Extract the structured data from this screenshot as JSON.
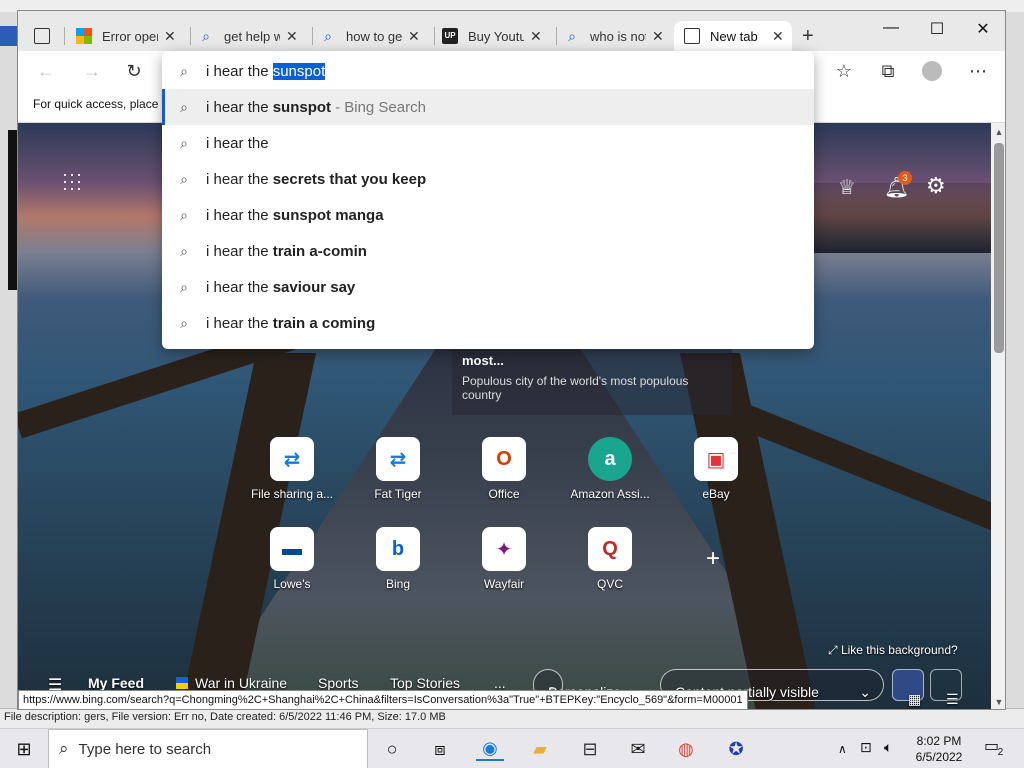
{
  "window": {
    "title": "New tab",
    "minimize": "—",
    "maximize": "☐",
    "close": "✕"
  },
  "tabs": [
    {
      "title": "Error opening",
      "icon": "workspaces-icon"
    },
    {
      "title": "get help with",
      "icon": "search-icon"
    },
    {
      "title": "how to get",
      "icon": "search-icon"
    },
    {
      "title": "Buy Youtube",
      "icon": "up-logo-icon",
      "icon_text": "UP"
    },
    {
      "title": "who is not",
      "icon": "search-icon"
    },
    {
      "title": "New tab",
      "icon": "new-tab-icon",
      "active": true
    }
  ],
  "new_tab_glyph": "+",
  "tab_close_glyph": "✕",
  "address": {
    "typed": "i hear the ",
    "completion": "sunspot"
  },
  "favorites_bar": {
    "text": "For quick access, place y"
  },
  "suggestions": [
    {
      "plain": "i hear the ",
      "bold": "sunspot",
      "suffix": "- Bing Search",
      "selected": true
    },
    {
      "plain": "i hear the",
      "bold": "",
      "suffix": ""
    },
    {
      "plain": "i hear the ",
      "bold": "secrets that you keep",
      "suffix": ""
    },
    {
      "plain": "i hear the ",
      "bold": "sunspot manga",
      "suffix": ""
    },
    {
      "plain": "i hear the ",
      "bold": "train a-comin",
      "suffix": ""
    },
    {
      "plain": "i hear the ",
      "bold": "saviour say",
      "suffix": ""
    },
    {
      "plain": "i hear the ",
      "bold": "train a coming",
      "suffix": ""
    }
  ],
  "notifications_count": "3",
  "infocard": {
    "headline": "most...",
    "subtitle": "Populous city of the world's most populous country"
  },
  "quick_links_row1": [
    {
      "label": "File sharing a...",
      "glyph": "⇄",
      "color": "#1a7bd4"
    },
    {
      "label": "Fat Tiger",
      "glyph": "⇄",
      "color": "#1a7bd4"
    },
    {
      "label": "Office",
      "glyph": "O",
      "color": "#d83b01"
    },
    {
      "label": "Amazon Assi...",
      "glyph": "a",
      "color": "#1aa58f"
    },
    {
      "label": "eBay",
      "glyph": "▣",
      "color": "#e53238"
    }
  ],
  "quick_links_row2": [
    {
      "label": "Lowe's",
      "glyph": "▬",
      "color": "#004990"
    },
    {
      "label": "Bing",
      "glyph": "b",
      "color": "#0a5fd6"
    },
    {
      "label": "Wayfair",
      "glyph": "✦",
      "color": "#7f187f"
    },
    {
      "label": "QVC",
      "glyph": "Q",
      "color": "#c62828"
    }
  ],
  "add_shortcut": "+",
  "like_background": "Like this background?",
  "feed": {
    "items": [
      "My Feed",
      "War in Ukraine",
      "Sports",
      "Top Stories"
    ],
    "more": "...",
    "personalize": "Personalize",
    "visibility": "Content partially visible"
  },
  "status_url": "https://www.bing.com/search?q=Chongming%2C+Shanghai%2C+China&filters=IsConversation%3a\"True\"+BTEPKey:\"Encyclo_569\"&form=M00001",
  "desktop_status": "File description: gers, File version: Err no, Date created: 6/5/2022 11:46 PM, Size: 17.0 MB",
  "taskbar": {
    "search_placeholder": "Type here to search",
    "time": "8:02 PM",
    "date": "6/5/2022",
    "notification_badge": "2"
  }
}
